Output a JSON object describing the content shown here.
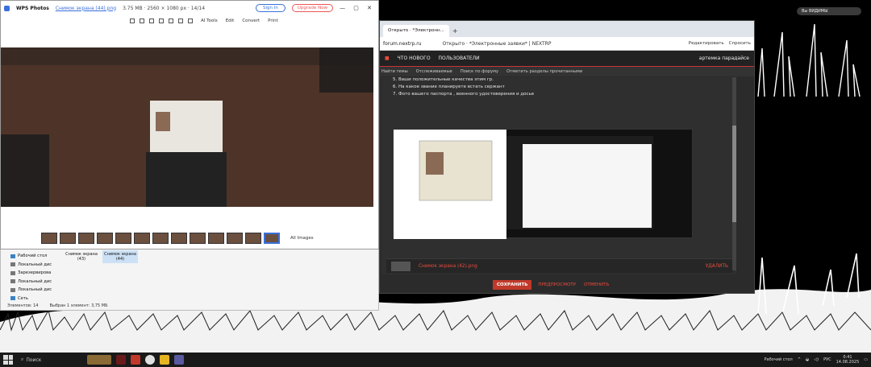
{
  "photos": {
    "app_name": "WPS Photos",
    "file_name": "Снимок экрана (44).png",
    "file_meta": "3.75 MB · 2560 × 1080 px · 14/14",
    "sign_in": "Sign In",
    "upgrade": "Upgrade Now",
    "toolbar": {
      "ai_tools": "AI Tools",
      "edit": "Edit",
      "convert": "Convert",
      "print": "Print"
    },
    "filmstrip_label": "All Images"
  },
  "explorer": {
    "nav": [
      {
        "label": "Рабочий стол"
      },
      {
        "label": "Локальный дис"
      },
      {
        "label": "Зарезервирова"
      },
      {
        "label": "Локальный дис"
      },
      {
        "label": "Локальный дис"
      },
      {
        "label": "Сеть"
      }
    ],
    "files": [
      {
        "label": "Снимок экрана (43)"
      },
      {
        "label": "Снимок экрана (44)"
      }
    ],
    "status_count": "Элементов: 14",
    "status_selected": "Выбран 1 элемент: 3,75 МБ"
  },
  "browser": {
    "tab_title": "Открыто · *Электронн...",
    "url": "forum.nextrp.ru",
    "page_title": "Открыто · *Электронные заявки* | NEXTRP",
    "actions": {
      "edit": "Редактировать",
      "ask": "Спросить"
    },
    "site_nav": {
      "whats_new": "ЧТО НОВОГО",
      "users": "ПОЛЬЗОВАТЕЛИ",
      "user": "артемка парадайсе"
    },
    "sub_nav": [
      "Найти темы",
      "Отслеживаемые",
      "Поиск по форуму",
      "Отметить разделы прочитанными"
    ],
    "post_lines": [
      "5. Ваши положительные качества этим гр.",
      "6. На какое звание планируете встать сержант",
      "7. Фото вашего паспорта , военного удостоверения и досье"
    ],
    "attachment": {
      "name": "Снимок экрана (42).png",
      "delete": "УДАЛИТЬ"
    },
    "buttons": {
      "save": "СОХРАНИТЬ",
      "preview": "ПРЕДПРОСМОТР",
      "cancel": "ОТМЕНИТЬ"
    }
  },
  "taskbar": {
    "search": "Поиск",
    "desktop": "Рабочий стол",
    "lang": "РУС",
    "time": "0:41",
    "date": "14.08.2025"
  },
  "widget": {
    "text": "Вы ВИДИМЫ"
  },
  "colors": {
    "accent_red": "#e84c3d",
    "wps_blue": "#3a6fdc",
    "forum_bg": "#2b2b2b"
  }
}
